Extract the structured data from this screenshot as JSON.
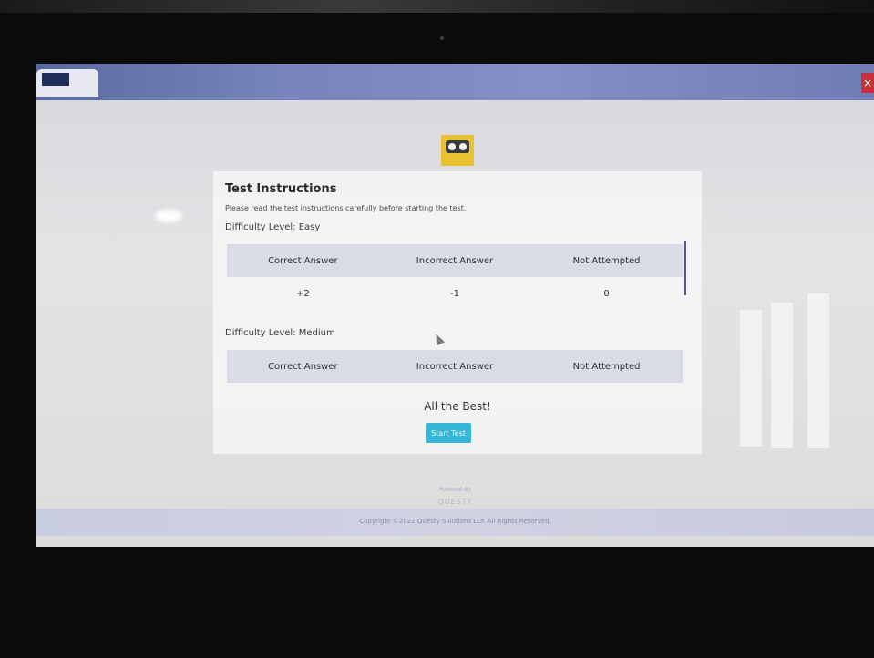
{
  "tab": {
    "label": ""
  },
  "close_icon": "×",
  "instructions": {
    "title": "Test Instructions",
    "subtitle": "Please read the test instructions carefully before starting the test.",
    "levels": [
      {
        "label": "Difficulty Level: Easy",
        "headers": [
          "Correct Answer",
          "Incorrect Answer",
          "Not Attempted"
        ],
        "values": [
          "+2",
          "-1",
          "0"
        ]
      },
      {
        "label": "Difficulty Level: Medium",
        "headers": [
          "Correct Answer",
          "Incorrect Answer",
          "Not Attempted"
        ]
      }
    ],
    "closing": "All the Best!",
    "start_button": "Start Test"
  },
  "footer": {
    "powered_by": "Powered By",
    "brand": "QUESTY",
    "copyright": "Copyright ©2022 Questy Solutions LLP. All Rights Reserved."
  },
  "colors": {
    "tabbar": "#7784bd",
    "start_button": "#35b6d6",
    "logo": "#e9c232"
  }
}
